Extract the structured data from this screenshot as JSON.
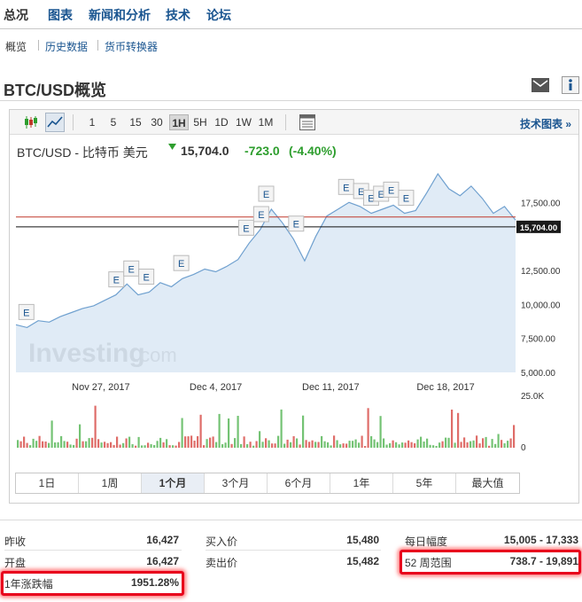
{
  "nav": {
    "tabs": [
      "总况",
      "图表",
      "新闻和分析",
      "技术",
      "论坛"
    ],
    "subtabs": [
      "概览",
      "历史数据",
      "货币转换器"
    ]
  },
  "page": {
    "title": "BTC/USD概览"
  },
  "icons": [
    "mail-icon",
    "info-icon"
  ],
  "toolbar": {
    "chart_type_icons": [
      "candlestick-icon",
      "line-chart-icon"
    ],
    "intervals": [
      "1",
      "5",
      "15",
      "30",
      "1H",
      "5H",
      "1D",
      "1W",
      "1M"
    ],
    "active_interval": "1H",
    "settings_icon": "settings-icon",
    "tech_chart_label": "技术图表 »"
  },
  "quote": {
    "name": "BTC/USD - 比特币 美元",
    "price": "15,704.0",
    "change": "-723.0",
    "change_pct": "(-4.40%)",
    "arrow_color": "#2e9e2e"
  },
  "watermark": {
    "text": "Investing",
    "suffix": ".com"
  },
  "chart_data": {
    "type": "area",
    "x_ticks": [
      "Nov 27, 2017",
      "Dec 4, 2017",
      "Dec 11, 2017",
      "Dec 18, 2017"
    ],
    "y_ticks": [
      "17,500.00",
      "12,500.00",
      "10,000.00",
      "7,500.00",
      "5,000.00"
    ],
    "ylim": [
      5000,
      20000
    ],
    "current_value_label": "15,704.00",
    "current_value": 15704,
    "reference_line_value": 16427,
    "volume_ticks": [
      "25.0K",
      "0"
    ],
    "event_marker_label": "E",
    "events_x": [
      0.02,
      0.2,
      0.23,
      0.26,
      0.33,
      0.46,
      0.49,
      0.5,
      0.56,
      0.66,
      0.69,
      0.71,
      0.73,
      0.75,
      0.78
    ],
    "series": [
      {
        "values": [
          8500,
          8300,
          8800,
          8700,
          9100,
          9400,
          9700,
          9900,
          10300,
          10700,
          11500,
          10700,
          10900,
          11600,
          11300,
          11900,
          12200,
          12600,
          12400,
          12800,
          13300,
          14500,
          15500,
          17000,
          16000,
          14800,
          13200,
          15000,
          16500,
          17000,
          17500,
          17200,
          16700,
          17000,
          17300,
          16700,
          16900,
          18200,
          19600,
          18500,
          18000,
          18700,
          17800,
          16700,
          17200,
          16200
        ]
      }
    ],
    "line_color": "#6fa0cf",
    "fill_color": "#dbe8f4",
    "ref_line_color": "#c0392b"
  },
  "range_buttons": [
    "1日",
    "1周",
    "1个月",
    "3个月",
    "6个月",
    "1年",
    "5年",
    "最大值"
  ],
  "active_range": "1个月",
  "stats": {
    "col1": [
      {
        "label": "昨收",
        "value": "16,427"
      },
      {
        "label": "开盘",
        "value": "16,427"
      },
      {
        "label": "1年涨跌幅",
        "value": "1951.28%"
      }
    ],
    "col2": [
      {
        "label": "买入价",
        "value": "15,480"
      },
      {
        "label": "卖出价",
        "value": "15,482"
      }
    ],
    "col3": [
      {
        "label": "每日幅度",
        "value": "15,005 - 17,333"
      },
      {
        "label": "52 周范围",
        "value": "738.7 - 19,891"
      }
    ]
  },
  "colors": {
    "link": "#1a5590",
    "positive": "#2e9e2e",
    "highlight": "#e8001c"
  }
}
